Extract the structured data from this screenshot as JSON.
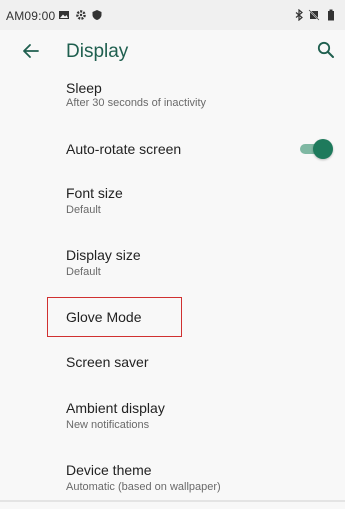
{
  "status_bar": {
    "time": "AM09:00",
    "left_icons": [
      "image-icon",
      "gear-icon",
      "shield-icon"
    ],
    "right_icons": [
      "bluetooth-icon",
      "no-sim-icon",
      "battery-icon"
    ]
  },
  "toolbar": {
    "title": "Display",
    "back_icon": "arrow-left-icon",
    "search_icon": "search-icon"
  },
  "settings": [
    {
      "title": "Sleep",
      "subtitle": "After 30 seconds of inactivity"
    },
    {
      "title": "Auto-rotate screen",
      "toggle": true
    },
    {
      "title": "Font size",
      "subtitle": "Default"
    },
    {
      "title": "Display size",
      "subtitle": "Default"
    },
    {
      "title": "Glove Mode",
      "highlighted": true
    },
    {
      "title": "Screen saver"
    },
    {
      "title": "Ambient display",
      "subtitle": "New notifications"
    },
    {
      "title": "Device theme",
      "subtitle": "Automatic (based on wallpaper)"
    }
  ],
  "colors": {
    "accent": "#1e7a5c",
    "title": "#1f5f4f",
    "highlight_border": "#d03030"
  }
}
